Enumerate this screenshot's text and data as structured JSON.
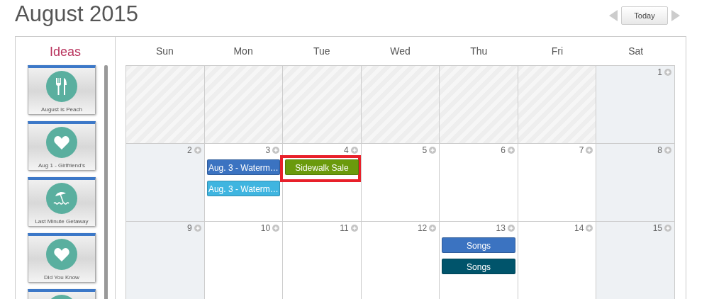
{
  "header": {
    "title": "August 2015",
    "today_button": "Today"
  },
  "sidebar": {
    "title": "Ideas",
    "items": [
      {
        "label": "August is Peach",
        "kind": "cutlery"
      },
      {
        "label": "Aug 1 - Girlfriend's",
        "kind": "heart"
      },
      {
        "label": "Last Minute Getaway",
        "kind": "beach"
      },
      {
        "label": "Did You Know",
        "kind": "heart"
      },
      {
        "kind": "blank"
      }
    ]
  },
  "calendar": {
    "weekdays": [
      "Sun",
      "Mon",
      "Tue",
      "Wed",
      "Thu",
      "Fri",
      "Sat"
    ],
    "weeks": [
      [
        {
          "kind": "outside"
        },
        {
          "kind": "outside"
        },
        {
          "kind": "outside"
        },
        {
          "kind": "outside"
        },
        {
          "kind": "outside"
        },
        {
          "kind": "outside"
        },
        {
          "kind": "weekend",
          "day": "1"
        }
      ],
      [
        {
          "kind": "weekend",
          "day": "2"
        },
        {
          "kind": "weekday",
          "day": "3",
          "events": [
            {
              "title": "Aug. 3 - Waterm…",
              "color": "#3b73c1",
              "highlighted": false
            },
            {
              "title": "Aug. 3 - Waterm…",
              "color": "#3fb5e0",
              "highlighted": false
            }
          ]
        },
        {
          "kind": "weekday",
          "day": "4",
          "events": [
            {
              "title": "Sidewalk Sale",
              "color": "#6a9a0c",
              "highlighted": true
            }
          ]
        },
        {
          "kind": "weekday",
          "day": "5"
        },
        {
          "kind": "weekday",
          "day": "6"
        },
        {
          "kind": "weekday",
          "day": "7"
        },
        {
          "kind": "weekend",
          "day": "8"
        }
      ],
      [
        {
          "kind": "weekend",
          "day": "9"
        },
        {
          "kind": "weekday",
          "day": "10"
        },
        {
          "kind": "weekday",
          "day": "11"
        },
        {
          "kind": "weekday",
          "day": "12"
        },
        {
          "kind": "weekday",
          "day": "13",
          "events": [
            {
              "title": "Songs",
              "color": "#3b73c1",
              "highlighted": false
            },
            {
              "title": "Songs",
              "color": "#00546b",
              "highlighted": false
            }
          ]
        },
        {
          "kind": "weekday",
          "day": "14"
        },
        {
          "kind": "weekend",
          "day": "15"
        }
      ]
    ]
  }
}
